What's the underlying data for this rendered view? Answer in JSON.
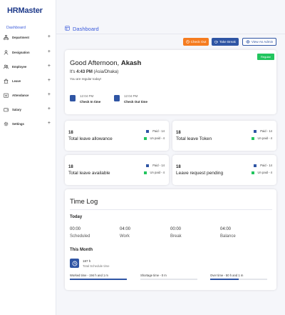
{
  "app": {
    "logo_prefix": "HR",
    "logo_suffix": "Master"
  },
  "sidebar": {
    "active": "Dashboard",
    "items": [
      {
        "label": "Department",
        "icon": "hierarchy-icon"
      },
      {
        "label": "Designation",
        "icon": "designation-icon"
      },
      {
        "label": "Employee",
        "icon": "users-icon"
      },
      {
        "label": "Leave",
        "icon": "leave-icon"
      },
      {
        "label": "Attendance",
        "icon": "attendance-icon"
      },
      {
        "label": "Salary",
        "icon": "wallet-icon"
      },
      {
        "label": "Settings",
        "icon": "gear-icon"
      }
    ]
  },
  "header": {
    "title": "Dashboard"
  },
  "actions": {
    "check_out": "Check Out",
    "take_break": "Take Break",
    "view_as_admin": "View As Admin"
  },
  "welcome": {
    "badge": "Regular",
    "greeting": "Good Afternoon,",
    "name": "Akash",
    "time_prefix": "It's",
    "time": "4:43 PM",
    "timezone": "(Asia/Dhaka)",
    "status_text": "You are regular today!",
    "check_in_time": "12:04 PM",
    "check_in_label": "Check In time",
    "check_out_time": "12:04 PM",
    "check_out_label": "Check Out time"
  },
  "leave_cards": [
    {
      "count": "18",
      "title": "Total leave allowance",
      "paid": "Paid - 14",
      "unpaid": "Un paid - 4"
    },
    {
      "count": "18",
      "title": "Total leave Token",
      "paid": "Paid - 14",
      "unpaid": "Un paid - 4"
    },
    {
      "count": "18",
      "title": "Total leave available",
      "paid": "Paid - 14",
      "unpaid": "Un paid - 4"
    },
    {
      "count": "18",
      "title": "Leave request pending",
      "paid": "Paid - 14",
      "unpaid": "Un paid - 4"
    }
  ],
  "time_log": {
    "title": "Time Log",
    "today_label": "Today",
    "today": [
      {
        "value": "00:00",
        "label": "Scheduled"
      },
      {
        "value": "04:00",
        "label": "Work"
      },
      {
        "value": "00:00",
        "label": "Break"
      },
      {
        "value": "04:00",
        "label": "Balance"
      }
    ],
    "month_label": "This Month",
    "schedule_value": "187 h",
    "schedule_label": "Total Schedule time",
    "worked_label": "Worked time - 194 h and 1 m",
    "worked_fraction": 1.0,
    "shortage_label": "Shortage time - 0 m",
    "shortage_fraction": 0.0,
    "overtime_label": "Over time - 50 h and 1 m",
    "overtime_fraction": 0.5
  },
  "colors": {
    "primary": "#2f55a4",
    "accent_link": "#3b5bdb",
    "check_out": "#f57c20",
    "paid": "#2f55a4",
    "unpaid": "#22c55e",
    "badge": "#22c55e"
  }
}
